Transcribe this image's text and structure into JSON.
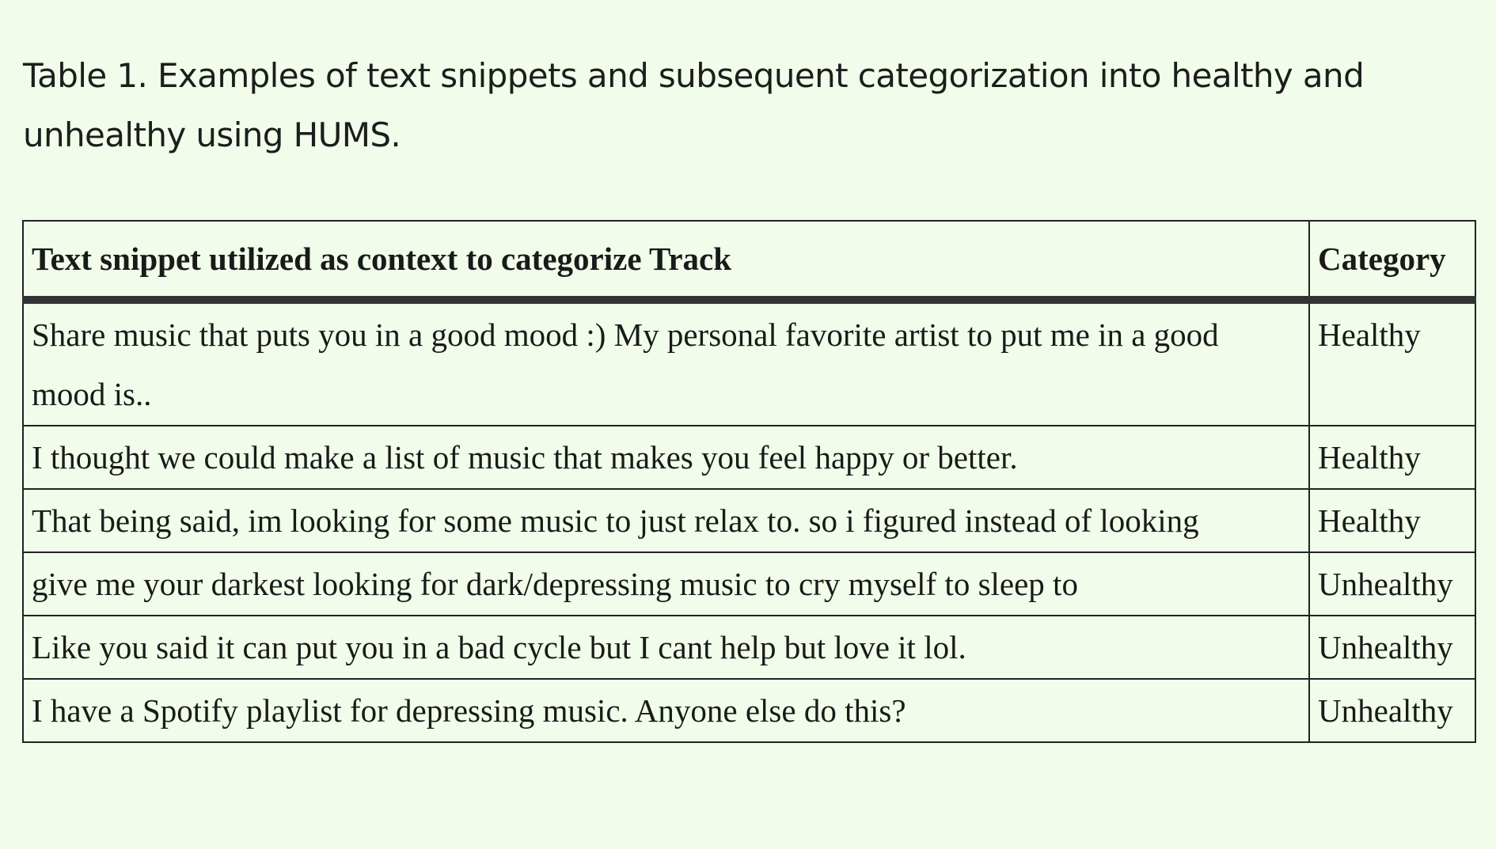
{
  "caption": "Table 1. Examples of text snippets and subsequent categorization into healthy and unhealthy using HUMS.",
  "table": {
    "headers": [
      "Text snippet utilized as context to categorize Track",
      "Category"
    ],
    "rows": [
      {
        "snippet": "Share music that puts you in a good mood :) My personal favorite artist to put me in a good mood is..",
        "category": "Healthy"
      },
      {
        "snippet": "I thought we could make a list of music that makes you feel happy or better.",
        "category": "Healthy"
      },
      {
        "snippet": "That being said, im looking for some music to just relax to. so i figured instead of looking",
        "category": "Healthy"
      },
      {
        "snippet": "give me your darkest looking for dark/depressing music to cry myself to sleep to",
        "category": "Unhealthy"
      },
      {
        "snippet": "Like you said it can put you in a bad cycle but I cant help but love it lol.",
        "category": "Unhealthy"
      },
      {
        "snippet": "I have a Spotify playlist for depressing music. Anyone else do this?",
        "category": "Unhealthy"
      }
    ]
  }
}
